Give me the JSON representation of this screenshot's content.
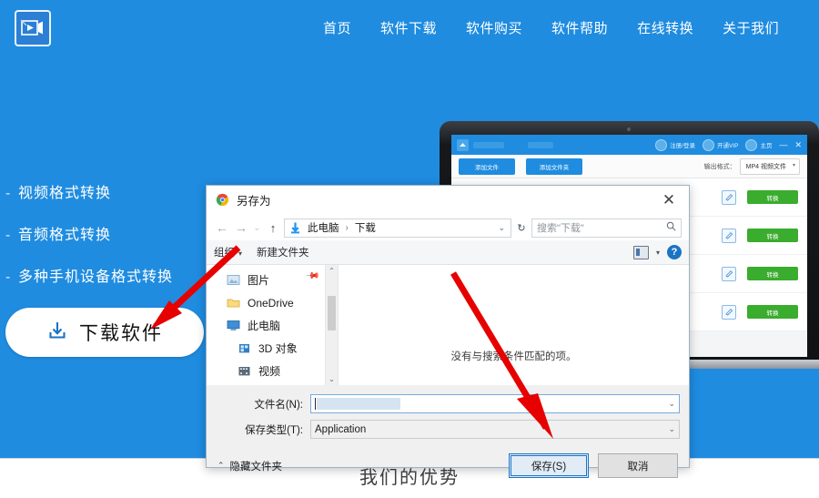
{
  "site": {
    "logo_icon": "video-film-icon",
    "nav": [
      {
        "label": "首页"
      },
      {
        "label": "软件下载"
      },
      {
        "label": "软件购买"
      },
      {
        "label": "软件帮助"
      },
      {
        "label": "在线转换"
      },
      {
        "label": "关于我们"
      }
    ],
    "features": [
      {
        "bullet": "-",
        "label": "视频格式转换"
      },
      {
        "bullet": "-",
        "label": "音频格式转换"
      },
      {
        "bullet": "-",
        "label": "多种手机设备格式转换"
      }
    ],
    "download_button": {
      "label": "下载软件",
      "icon": "download-icon"
    },
    "footer_heading": "我们的优势",
    "colors": {
      "brand_blue": "#1f8ce0",
      "accent_white": "#ffffff",
      "arrow_red": "#e60000",
      "convert_green": "#3aac2e"
    }
  },
  "app_window": {
    "titlebar": {
      "app_icon": "app-logo-icon",
      "chips": [
        {
          "icon": "user-icon",
          "label": "注册/登录"
        },
        {
          "icon": "vip-icon",
          "label": "开通VIP"
        },
        {
          "icon": "home-icon",
          "label": "主页"
        }
      ],
      "minimize": "—",
      "close": "✕"
    },
    "toolbar": {
      "buttons": [
        {
          "label": "添加文件"
        },
        {
          "label": "添加文件夹"
        }
      ],
      "output_label": "输出格式：",
      "output_value": "MP4 视频文件",
      "caret": "▾"
    },
    "rows": [
      {
        "convert_label": "转换",
        "edit_icon": "edit-icon"
      },
      {
        "convert_label": "转换",
        "edit_icon": "edit-icon"
      },
      {
        "convert_label": "转换",
        "edit_icon": "edit-icon"
      },
      {
        "convert_label": "转换",
        "edit_icon": "edit-icon"
      }
    ]
  },
  "dialog": {
    "title": "另存为",
    "title_icon": "chrome-icon",
    "close_icon": "✕",
    "nav": {
      "back": "←",
      "forward": "→",
      "recent": "⌄",
      "up": "↑",
      "folder_icon": "download-arrow-icon",
      "breadcrumb": [
        {
          "label": "此电脑"
        },
        {
          "label": "下载"
        }
      ],
      "separator": "›",
      "dropdown_caret": "⌄",
      "refresh": "↻"
    },
    "search": {
      "placeholder": "搜索\"下载\"",
      "icon": "search-icon"
    },
    "toolbar": {
      "organize": "组织",
      "organize_caret": "▾",
      "new_folder": "新建文件夹",
      "view_icon": "view-mode-icon",
      "view_caret": "▾",
      "help_icon": "?"
    },
    "sidebar": {
      "items": [
        {
          "label": "图片",
          "icon": "pictures-icon",
          "indent": false,
          "pinned": true
        },
        {
          "label": "OneDrive",
          "icon": "onedrive-icon",
          "indent": false,
          "pinned": false
        },
        {
          "label": "此电脑",
          "icon": "this-pc-icon",
          "indent": false,
          "pinned": false
        },
        {
          "label": "3D 对象",
          "icon": "3d-objects-icon",
          "indent": true,
          "pinned": false
        },
        {
          "label": "视频",
          "icon": "videos-icon",
          "indent": true,
          "pinned": false
        }
      ],
      "scroll_up": "⌃",
      "scroll_down": "⌄"
    },
    "file_list": {
      "empty_message": "没有与搜索条件匹配的项。"
    },
    "fields": [
      {
        "label": "文件名(N):",
        "value": "",
        "caret": "⌄",
        "type": "combobox-editable"
      },
      {
        "label": "保存类型(T):",
        "value": "Application",
        "caret": "⌄",
        "type": "combobox-readonly"
      }
    ],
    "hide_folders": {
      "label": "隐藏文件夹",
      "chevron": "⌃"
    },
    "buttons": [
      {
        "label": "保存(S)",
        "primary": true
      },
      {
        "label": "取消",
        "primary": false
      }
    ]
  },
  "annotations": {
    "arrow_1": {
      "color": "#e60000",
      "points_to": "下载软件"
    },
    "arrow_2": {
      "color": "#e60000",
      "points_to": "保存(S)"
    }
  }
}
